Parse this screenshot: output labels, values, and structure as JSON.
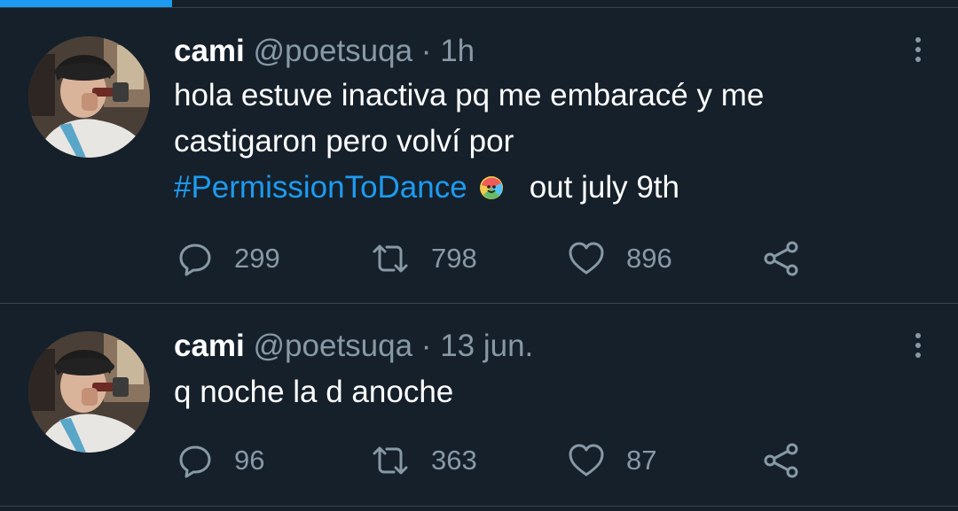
{
  "loading_bar": {
    "progress": 0.18
  },
  "tweets": [
    {
      "name": "cami",
      "handle": "@poetsuqa",
      "separator": "·",
      "time": "1h",
      "text_line1": "hola estuve inactiva pq me embaracé y me",
      "text_line2": "castigaron pero volví por",
      "hashtag": "#PermissionToDance",
      "emoji": "ptd-hashflag-icon",
      "text_after": "out july 9th",
      "replies": "299",
      "retweets": "798",
      "likes": "896"
    },
    {
      "name": "cami",
      "handle": "@poetsuqa",
      "separator": "·",
      "time": "13 jun.",
      "text_line1": "q noche la d anoche",
      "replies": "96",
      "retweets": "363",
      "likes": "87"
    }
  ],
  "colors": {
    "background": "#15202b",
    "accent": "#1d9bf0",
    "secondary_text": "#8899a6",
    "divider": "#38444d"
  }
}
